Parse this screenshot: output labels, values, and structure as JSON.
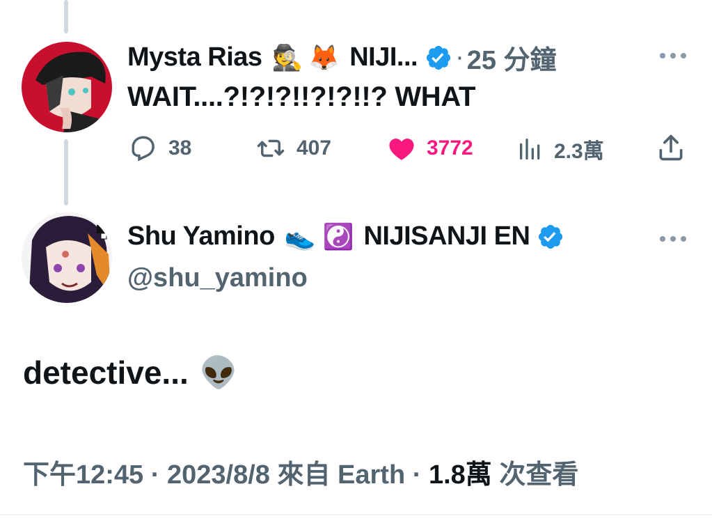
{
  "reply_tweet": {
    "display_name": "Mysta Rias",
    "name_emojis": [
      "🕵️",
      "🦊"
    ],
    "name_suffix": "NIJI...",
    "dot": "·",
    "time_ago": "25 分鐘",
    "text": "WAIT....?!?!?!!?!?!!? WHAT",
    "actions": {
      "reply_count": "38",
      "retweet_count": "407",
      "like_count": "3772",
      "views_count": "2.3萬"
    }
  },
  "main_tweet": {
    "display_name": "Shu Yamino",
    "name_emojis": [
      "👟",
      "☯️"
    ],
    "name_suffix": "NIJISANJI EN",
    "handle": "@shu_yamino",
    "text": "detective...",
    "text_emoji": "👽",
    "meta": {
      "time": "下午12:45",
      "sep1": "·",
      "date": "2023/8/8",
      "source": "來自 Earth",
      "sep2": "·",
      "views": "1.8萬",
      "views_label": "次查看"
    }
  },
  "colors": {
    "verified": "#1d9bf0",
    "like": "#f91880",
    "muted": "#536471",
    "text": "#0f1419",
    "thread_line": "#cfd9de"
  }
}
